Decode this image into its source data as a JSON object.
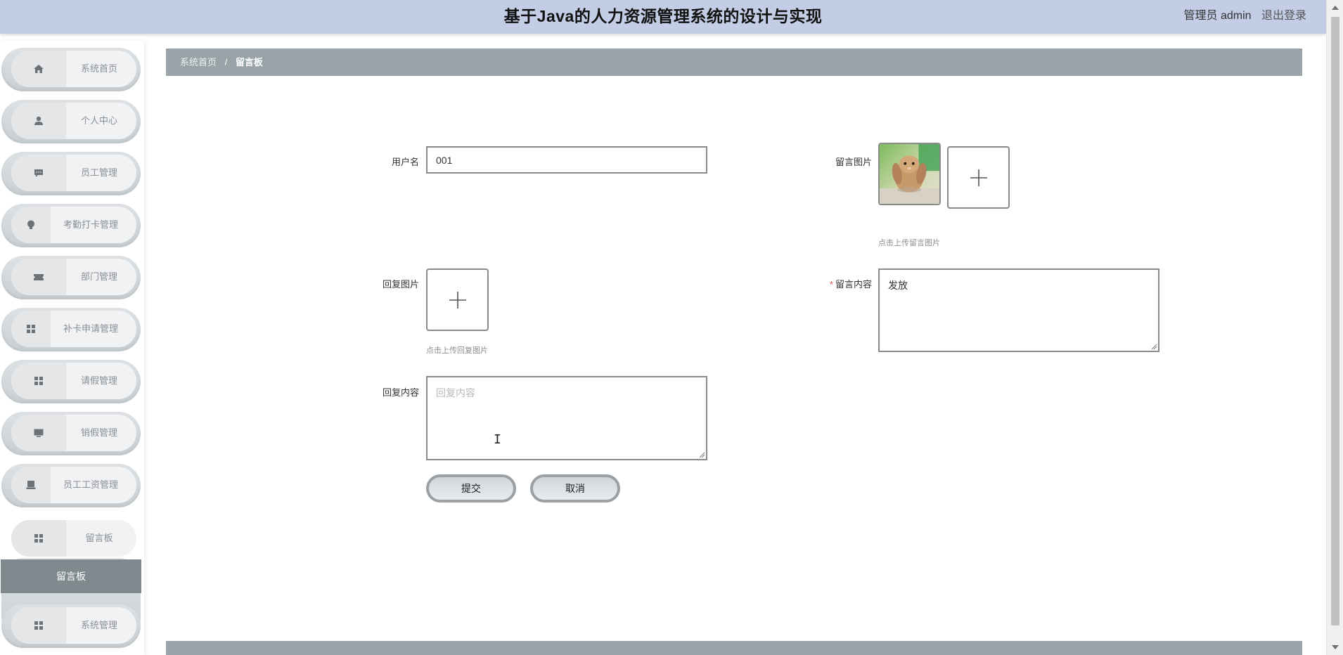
{
  "header": {
    "title": "基于Java的人力资源管理系统的设计与实现",
    "user_role": "管理员 admin",
    "logout": "退出登录"
  },
  "sidebar": {
    "items": [
      {
        "label": "系统首页",
        "icon": "home-icon"
      },
      {
        "label": "个人中心",
        "icon": "user-icon"
      },
      {
        "label": "员工管理",
        "icon": "chat-icon"
      },
      {
        "label": "考勤打卡管理",
        "icon": "bulb-icon"
      },
      {
        "label": "部门管理",
        "icon": "ticket-icon"
      },
      {
        "label": "补卡申请管理",
        "icon": "grid-icon"
      },
      {
        "label": "请假管理",
        "icon": "grid-icon"
      },
      {
        "label": "销假管理",
        "icon": "monitor-icon"
      },
      {
        "label": "员工工资管理",
        "icon": "printer-icon"
      },
      {
        "label": "留言板",
        "icon": "grid-icon"
      },
      {
        "label": "系统管理",
        "icon": "grid-icon"
      }
    ],
    "submenu_active": "留言板"
  },
  "breadcrumb": {
    "home": "系统首页",
    "separator": "/",
    "current": "留言板"
  },
  "form": {
    "username_label": "用户名",
    "username_value": "001",
    "message_image_label": "留言图片",
    "message_image_hint": "点击上传留言图片",
    "reply_image_label": "回复图片",
    "reply_image_hint": "点击上传回复图片",
    "message_content_required": "*",
    "message_content_label": "留言内容",
    "message_content_value": "发放",
    "reply_content_label": "回复内容",
    "reply_content_placeholder": "回复内容",
    "submit_label": "提交",
    "cancel_label": "取消"
  }
}
